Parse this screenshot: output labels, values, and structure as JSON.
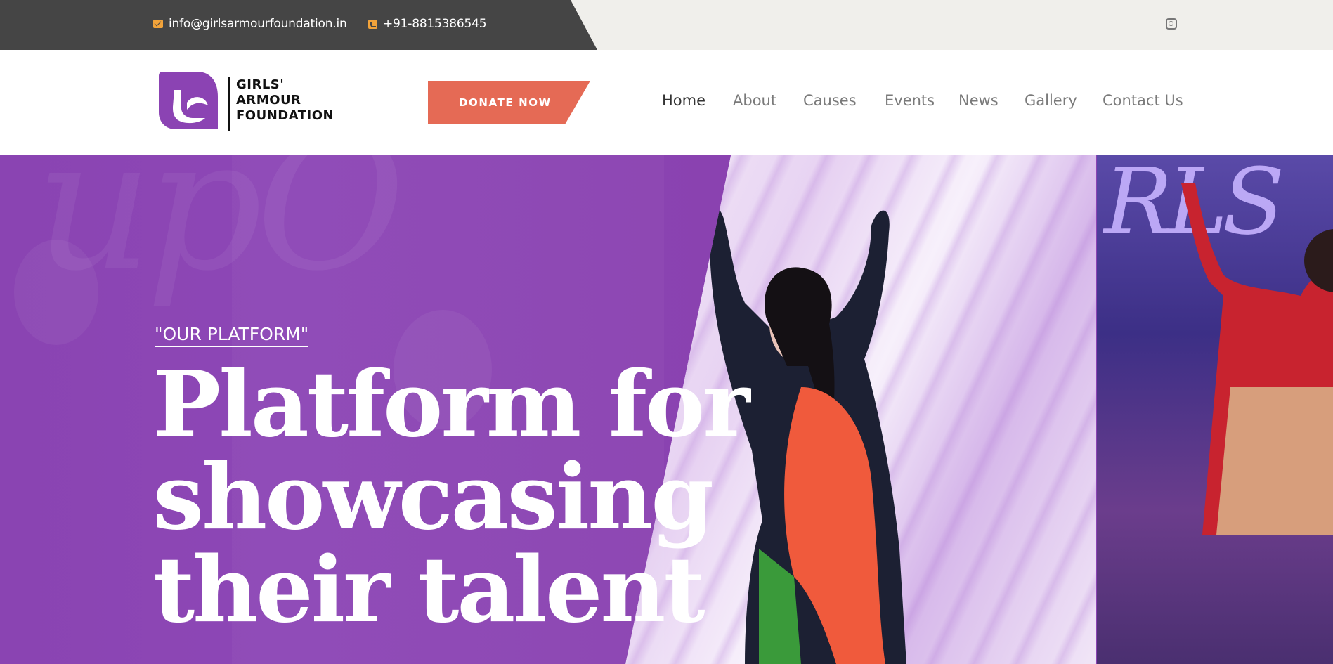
{
  "topbar": {
    "email": "info@girlsarmourfoundation.in",
    "phone": "+91-8815386545",
    "social_icon": "instagram-icon"
  },
  "header": {
    "logo_lines": [
      "GIRLS'",
      "ARMOUR",
      "FOUNDATION"
    ],
    "donate_label": "DONATE NOW",
    "nav": [
      "Home",
      "About",
      "Causes",
      "Events",
      "News",
      "Gallery",
      "Contact Us"
    ],
    "active_nav": "Home"
  },
  "hero": {
    "kicker": "\"OUR PLATFORM\"",
    "headline_lines": [
      "Platform for",
      "showcasing",
      "their talent"
    ]
  },
  "colors": {
    "purple": "#8b43b3",
    "donate": "#e56a55",
    "topbar_dark": "#454545",
    "icon_orange": "#f2a33a"
  }
}
